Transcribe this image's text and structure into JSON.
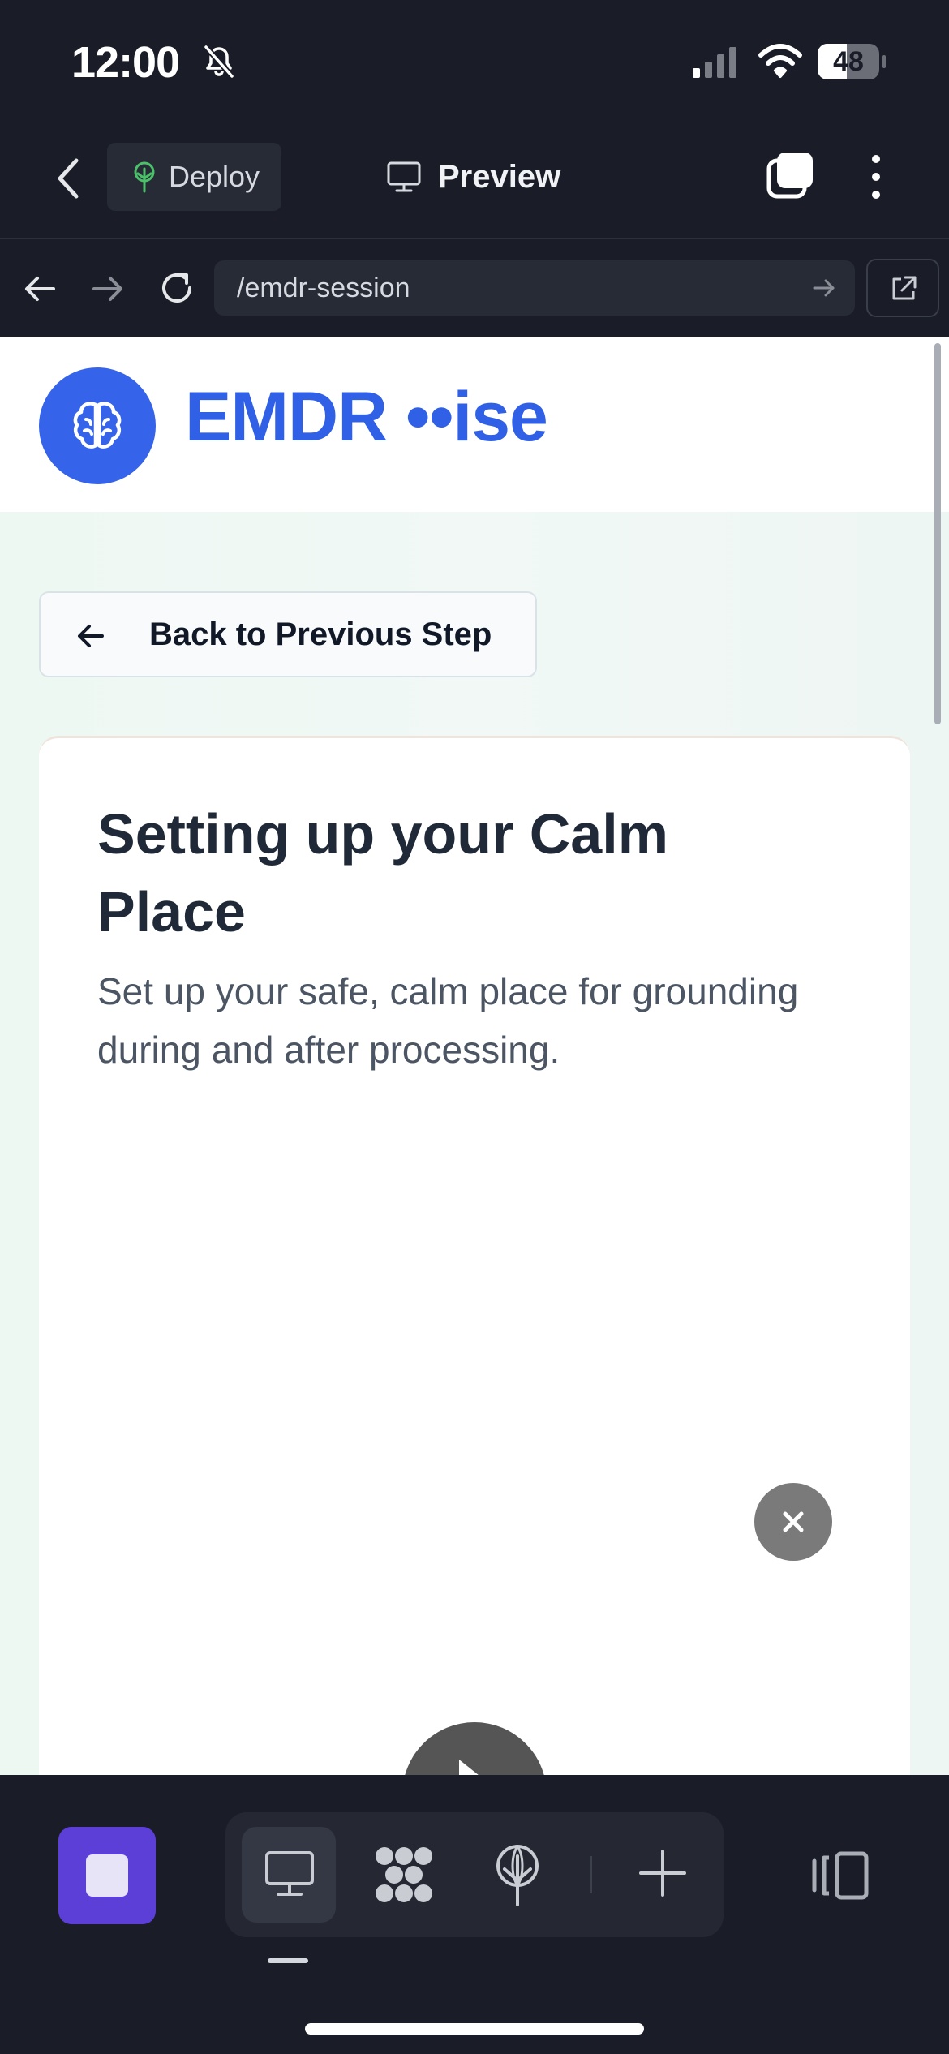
{
  "status_bar": {
    "time": "12:00",
    "battery": "48",
    "battery_fraction": 0.48,
    "icons": [
      "bell-slash-icon",
      "cellular-signal-icon",
      "wifi-icon",
      "battery-icon"
    ]
  },
  "toolbar": {
    "deploy_label": "Deploy",
    "preview_label": "Preview",
    "icons": [
      "chevron-left-icon",
      "tree-icon",
      "monitor-icon",
      "tabs-icon",
      "more-vertical-icon"
    ]
  },
  "browser": {
    "url": "/emdr-session",
    "icons": [
      "arrow-left-icon",
      "arrow-right-icon",
      "reload-icon",
      "arrow-right-icon",
      "external-link-icon"
    ]
  },
  "site": {
    "brand": "EMDR ••ise",
    "back_button": "Back to Previous Step",
    "card_title": "Setting up your Calm Place",
    "card_subtitle": "Set up your safe, calm place for grounding during and after processing.",
    "icons": [
      "brain-icon",
      "arrow-left-icon",
      "close-icon",
      "play-icon"
    ]
  },
  "bottom_bar": {
    "icons": [
      "stop-icon",
      "desktop-icon",
      "grid-icon",
      "deploy-tree-icon",
      "plus-icon",
      "panel-icon"
    ]
  },
  "colors": {
    "app_background": "#1a1d27",
    "brand_blue": "#3060e6",
    "accent_purple": "#5b3fd6",
    "deploy_green": "#4cbf6b"
  }
}
